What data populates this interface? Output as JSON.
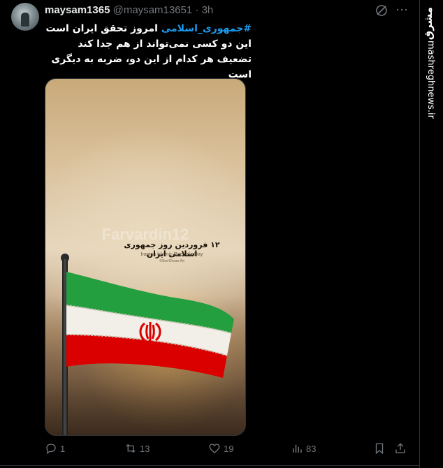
{
  "author": {
    "name": "maysam1365",
    "handle": "@maysam13651",
    "separator": "·",
    "time": "3h"
  },
  "tweet": {
    "hashtag": "#جمهوری_اسلامی",
    "line1_rest": " امروز تحقق ایران است",
    "line2": "این دو کسی نمی‌تواند از هم جدا کند",
    "line3": "تضعیف هر کدام از این دو، ضربه به دیگری است"
  },
  "media": {
    "watermark": "Farvardin12",
    "title": "۱۲ فروردین روز جمهوری اسلامی ایران",
    "subtitle": "Iranian Islamic Republic Day",
    "credit": "©Sed Ehsan Art",
    "flag_colors": {
      "green": "#239f40",
      "white": "#f2efe8",
      "red": "#da0000"
    }
  },
  "actions": {
    "replies": "1",
    "reposts": "13",
    "likes": "19",
    "views": "83"
  },
  "sidebar": {
    "brand": "مشرق",
    "url": "mashreghnews.ir"
  },
  "colors": {
    "accent": "#1d9bf0",
    "muted": "#71767b",
    "text": "#e7e9ea"
  }
}
